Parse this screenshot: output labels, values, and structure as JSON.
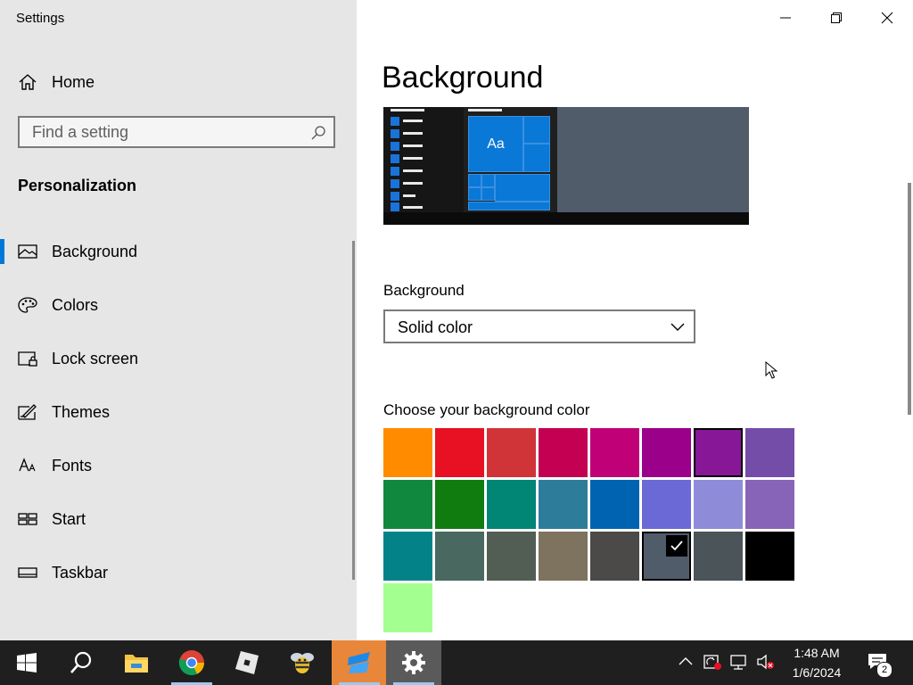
{
  "window": {
    "app_title": "Settings"
  },
  "sidebar": {
    "home_label": "Home",
    "search": {
      "placeholder": "Find a setting",
      "value": ""
    },
    "section_title": "Personalization",
    "items": [
      {
        "label": "Background",
        "icon": "picture-icon",
        "active": true
      },
      {
        "label": "Colors",
        "icon": "palette-icon",
        "active": false
      },
      {
        "label": "Lock screen",
        "icon": "lock-screen-icon",
        "active": false
      },
      {
        "label": "Themes",
        "icon": "themes-icon",
        "active": false
      },
      {
        "label": "Fonts",
        "icon": "fonts-icon",
        "active": false
      },
      {
        "label": "Start",
        "icon": "start-icon",
        "active": false
      },
      {
        "label": "Taskbar",
        "icon": "taskbar-icon",
        "active": false
      }
    ]
  },
  "main": {
    "page_title": "Background",
    "preview": {
      "tile_text": "Aa"
    },
    "background_label": "Background",
    "background_select": {
      "value": "Solid color"
    },
    "color_label": "Choose your background color",
    "swatches": [
      [
        "#ff8c00",
        "#e81123",
        "#d13438",
        "#c30052",
        "#bf0077",
        "#9a0089",
        "#881798",
        "#744da9"
      ],
      [
        "#10893e",
        "#107c10",
        "#018574",
        "#2d7d9a",
        "#0063b1",
        "#6b69d6",
        "#8e8cd8",
        "#8764b8"
      ],
      [
        "#038387",
        "#486860",
        "#525e54",
        "#7e735f",
        "#4c4a48",
        "#515c6b",
        "#4a5459",
        "#000000"
      ],
      [
        "#a4ff91"
      ]
    ],
    "selected_swatch": "#515c6b",
    "outlined_swatch": "#881798"
  },
  "taskbar": {
    "apps": [
      "windows-start-icon",
      "search-icon",
      "file-explorer-icon",
      "chrome-icon",
      "roblox-icon",
      "bee-app-icon",
      "roblox-studio-icon",
      "settings-gear-icon"
    ],
    "time": "1:48 AM",
    "date": "1/6/2024",
    "notification_count": "2"
  },
  "colors": {
    "accent": "#0078d7",
    "sidebar_bg": "#e6e6e6",
    "taskbar_bg": "#1f1f1f"
  }
}
